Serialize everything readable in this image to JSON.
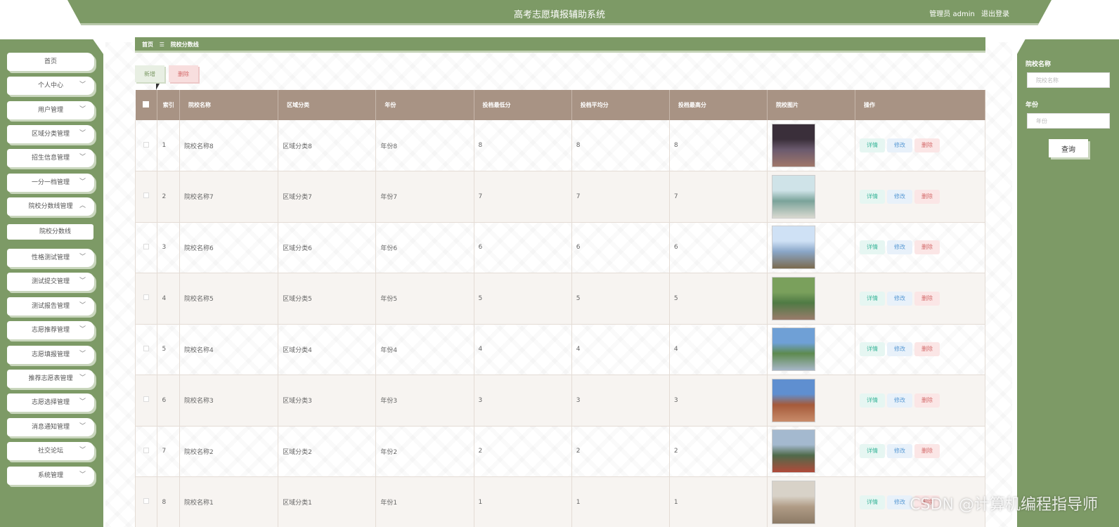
{
  "header": {
    "title": "高考志愿填报辅助系统",
    "user_label": "管理员 admin",
    "logout": "退出登录"
  },
  "sidebar": {
    "items": [
      {
        "label": "首页",
        "chevron": false
      },
      {
        "label": "个人中心",
        "chevron": true
      },
      {
        "label": "用户管理",
        "chevron": true
      },
      {
        "label": "区域分类管理",
        "chevron": true
      },
      {
        "label": "招生信息管理",
        "chevron": true
      },
      {
        "label": "一分一档管理",
        "chevron": true
      },
      {
        "label": "院校分数线管理",
        "chevron": true,
        "expanded": true
      },
      {
        "label": "性格测试管理",
        "chevron": true
      },
      {
        "label": "测试提交管理",
        "chevron": true
      },
      {
        "label": "测试报告管理",
        "chevron": true
      },
      {
        "label": "志愿推荐管理",
        "chevron": true
      },
      {
        "label": "志愿填报管理",
        "chevron": true
      },
      {
        "label": "推荐志愿表管理",
        "chevron": true
      },
      {
        "label": "志愿选择管理",
        "chevron": true
      },
      {
        "label": "消息通知管理",
        "chevron": true
      },
      {
        "label": "社交论坛",
        "chevron": true
      },
      {
        "label": "系统管理",
        "chevron": true
      }
    ],
    "sub_item": "院校分数线"
  },
  "breadcrumb": {
    "home": "首页",
    "separator": "☰",
    "current": "院校分数线"
  },
  "toolbar": {
    "add_label": "新增",
    "delete_label": "删除"
  },
  "search": {
    "name_label": "院校名称",
    "name_placeholder": "院校名称",
    "year_label": "年份",
    "year_placeholder": "年份",
    "query_label": "查询"
  },
  "table": {
    "headers": [
      "索引",
      "院校名称",
      "区域分类",
      "年份",
      "投档最低分",
      "投档平均分",
      "投档最高分",
      "院校图片",
      "操作"
    ],
    "rows": [
      {
        "index": "1",
        "name": "院校名称8",
        "region": "区域分类8",
        "year": "年份8",
        "min": "8",
        "avg": "8",
        "max": "8"
      },
      {
        "index": "2",
        "name": "院校名称7",
        "region": "区域分类7",
        "year": "年份7",
        "min": "7",
        "avg": "7",
        "max": "7"
      },
      {
        "index": "3",
        "name": "院校名称6",
        "region": "区域分类6",
        "year": "年份6",
        "min": "6",
        "avg": "6",
        "max": "6"
      },
      {
        "index": "4",
        "name": "院校名称5",
        "region": "区域分类5",
        "year": "年份5",
        "min": "5",
        "avg": "5",
        "max": "5"
      },
      {
        "index": "5",
        "name": "院校名称4",
        "region": "区域分类4",
        "year": "年份4",
        "min": "4",
        "avg": "4",
        "max": "4"
      },
      {
        "index": "6",
        "name": "院校名称3",
        "region": "区域分类3",
        "year": "年份3",
        "min": "3",
        "avg": "3",
        "max": "3"
      },
      {
        "index": "7",
        "name": "院校名称2",
        "region": "区域分类2",
        "year": "年份2",
        "min": "2",
        "avg": "2",
        "max": "2"
      },
      {
        "index": "8",
        "name": "院校名称1",
        "region": "区域分类1",
        "year": "年份1",
        "min": "1",
        "avg": "1",
        "max": "1"
      }
    ],
    "actions": {
      "detail": "详情",
      "edit": "修改",
      "delete": "删除"
    }
  },
  "watermark": "CSDN @计算机编程指导师",
  "colors": {
    "primary": "#7d9a66",
    "table_header": "#a89384"
  }
}
